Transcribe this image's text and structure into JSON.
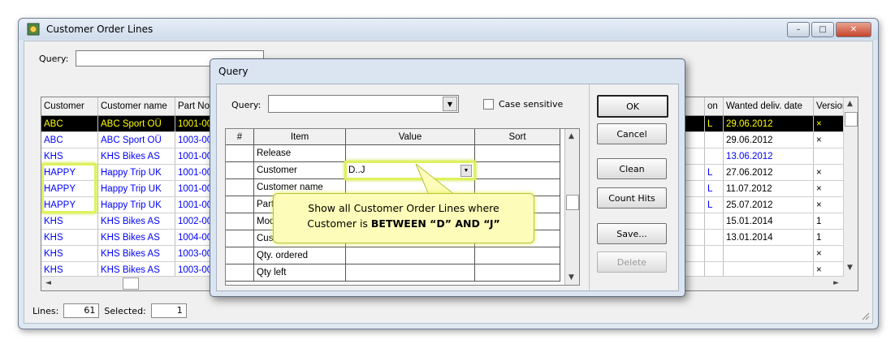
{
  "window": {
    "title": "Customer Order Lines",
    "query_label": "Query:",
    "query_value": "",
    "buttons": {
      "minimize": "–",
      "maximize": "□",
      "close": "✕"
    }
  },
  "grid": {
    "left_columns": [
      "Customer",
      "Customer name",
      "Part No"
    ],
    "right_columns": [
      "on",
      "Wanted deliv. date",
      "Version"
    ],
    "rows": [
      {
        "customer": "ABC",
        "name": "ABC Sport OÜ",
        "part": "1001-00",
        "on": "L",
        "date": "29.06.2012",
        "version": "×",
        "selected": true
      },
      {
        "customer": "ABC",
        "name": "ABC Sport OÜ",
        "part": "1003-00",
        "on": "",
        "date": "29.06.2012",
        "version": "×"
      },
      {
        "customer": "KHS",
        "name": "KHS Bikes AS",
        "part": "1001-00",
        "on": "",
        "date": "13.06.2012",
        "version": ""
      },
      {
        "customer": "HAPPY",
        "name": "Happy Trip UK",
        "part": "1001-00",
        "on": "L",
        "date": "27.06.2012",
        "version": "×"
      },
      {
        "customer": "HAPPY",
        "name": "Happy Trip UK",
        "part": "1001-00",
        "on": "L",
        "date": "11.07.2012",
        "version": "×"
      },
      {
        "customer": "HAPPY",
        "name": "Happy Trip UK",
        "part": "1001-00",
        "on": "L",
        "date": "25.07.2012",
        "version": "×"
      },
      {
        "customer": "KHS",
        "name": "KHS Bikes AS",
        "part": "1002-00",
        "on": "",
        "date": "15.01.2014",
        "version": "1"
      },
      {
        "customer": "KHS",
        "name": "KHS Bikes AS",
        "part": "1004-00",
        "on": "",
        "date": "13.01.2014",
        "version": "1"
      },
      {
        "customer": "KHS",
        "name": "KHS Bikes AS",
        "part": "1003-00",
        "on": "",
        "date": "",
        "version": "×"
      },
      {
        "customer": "KHS",
        "name": "KHS Bikes AS",
        "part": "1003-00",
        "on": "",
        "date": "",
        "version": "×"
      }
    ]
  },
  "status": {
    "lines_label": "Lines:",
    "lines_value": "61",
    "selected_label": "Selected:",
    "selected_value": "1"
  },
  "dialog": {
    "title": "Query",
    "query_label": "Query:",
    "query_value": "",
    "case_sensitive_label": "Case sensitive",
    "columns": [
      "#",
      "Item",
      "Value",
      "Sort"
    ],
    "rows": [
      {
        "item": "Release",
        "value": "",
        "sort": ""
      },
      {
        "item": "Customer",
        "value": "D..J",
        "sort": ""
      },
      {
        "item": "Customer name",
        "value": "",
        "sort": ""
      },
      {
        "item": "Part",
        "value": "",
        "sort": ""
      },
      {
        "item": "Mod",
        "value": "",
        "sort": ""
      },
      {
        "item": "Cust",
        "value": "",
        "sort": ""
      },
      {
        "item": "Qty. ordered",
        "value": "",
        "sort": ""
      },
      {
        "item": "Qty left",
        "value": "",
        "sort": ""
      }
    ],
    "buttons": {
      "ok": "OK",
      "cancel": "Cancel",
      "clean": "Clean",
      "count_hits": "Count Hits",
      "save": "Save...",
      "delete": "Delete"
    }
  },
  "callout": {
    "line1": "Show all Customer Order Lines where",
    "line2_prefix": "Customer is ",
    "line2_bold": "BETWEEN “D” AND “J”"
  },
  "colors": {
    "highlight": "#dff15b",
    "link_blue": "#0000ff",
    "selected_bg": "#000000",
    "selected_fg": "#ffff00"
  }
}
